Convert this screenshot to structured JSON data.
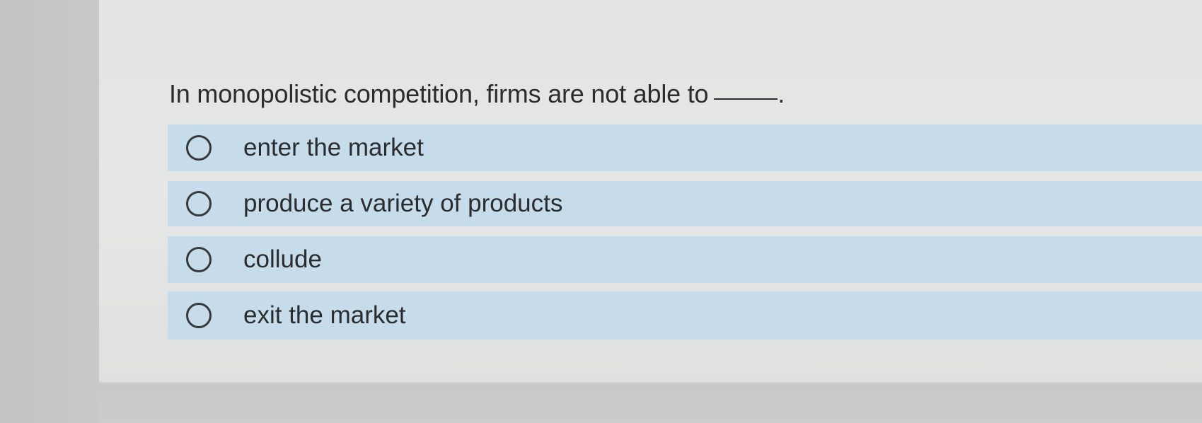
{
  "question": {
    "text": "In monopolistic competition, firms are not able to",
    "suffix": "."
  },
  "options": [
    {
      "label": "enter the market",
      "selected": false
    },
    {
      "label": "produce a variety of products",
      "selected": false
    },
    {
      "label": "collude",
      "selected": false
    },
    {
      "label": "exit the market",
      "selected": false
    }
  ],
  "colors": {
    "option_background": "#c6dcea",
    "text": "#2a2c30",
    "card_background": "#e3e5e4"
  }
}
